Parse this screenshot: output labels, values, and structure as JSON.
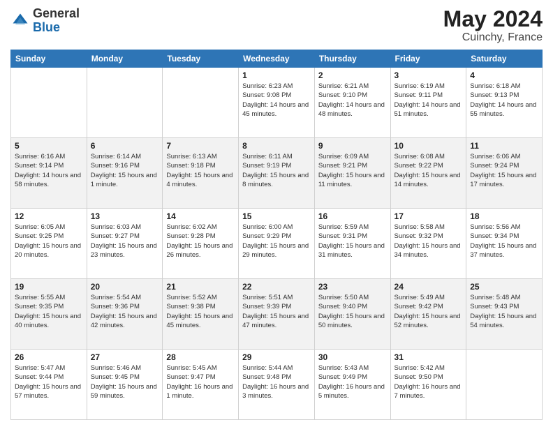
{
  "header": {
    "logo_general": "General",
    "logo_blue": "Blue",
    "month": "May 2024",
    "location": "Cuinchy, France"
  },
  "weekdays": [
    "Sunday",
    "Monday",
    "Tuesday",
    "Wednesday",
    "Thursday",
    "Friday",
    "Saturday"
  ],
  "weeks": [
    [
      {
        "day": "",
        "sunrise": "",
        "sunset": "",
        "daylight": ""
      },
      {
        "day": "",
        "sunrise": "",
        "sunset": "",
        "daylight": ""
      },
      {
        "day": "",
        "sunrise": "",
        "sunset": "",
        "daylight": ""
      },
      {
        "day": "1",
        "sunrise": "Sunrise: 6:23 AM",
        "sunset": "Sunset: 9:08 PM",
        "daylight": "Daylight: 14 hours and 45 minutes."
      },
      {
        "day": "2",
        "sunrise": "Sunrise: 6:21 AM",
        "sunset": "Sunset: 9:10 PM",
        "daylight": "Daylight: 14 hours and 48 minutes."
      },
      {
        "day": "3",
        "sunrise": "Sunrise: 6:19 AM",
        "sunset": "Sunset: 9:11 PM",
        "daylight": "Daylight: 14 hours and 51 minutes."
      },
      {
        "day": "4",
        "sunrise": "Sunrise: 6:18 AM",
        "sunset": "Sunset: 9:13 PM",
        "daylight": "Daylight: 14 hours and 55 minutes."
      }
    ],
    [
      {
        "day": "5",
        "sunrise": "Sunrise: 6:16 AM",
        "sunset": "Sunset: 9:14 PM",
        "daylight": "Daylight: 14 hours and 58 minutes."
      },
      {
        "day": "6",
        "sunrise": "Sunrise: 6:14 AM",
        "sunset": "Sunset: 9:16 PM",
        "daylight": "Daylight: 15 hours and 1 minute."
      },
      {
        "day": "7",
        "sunrise": "Sunrise: 6:13 AM",
        "sunset": "Sunset: 9:18 PM",
        "daylight": "Daylight: 15 hours and 4 minutes."
      },
      {
        "day": "8",
        "sunrise": "Sunrise: 6:11 AM",
        "sunset": "Sunset: 9:19 PM",
        "daylight": "Daylight: 15 hours and 8 minutes."
      },
      {
        "day": "9",
        "sunrise": "Sunrise: 6:09 AM",
        "sunset": "Sunset: 9:21 PM",
        "daylight": "Daylight: 15 hours and 11 minutes."
      },
      {
        "day": "10",
        "sunrise": "Sunrise: 6:08 AM",
        "sunset": "Sunset: 9:22 PM",
        "daylight": "Daylight: 15 hours and 14 minutes."
      },
      {
        "day": "11",
        "sunrise": "Sunrise: 6:06 AM",
        "sunset": "Sunset: 9:24 PM",
        "daylight": "Daylight: 15 hours and 17 minutes."
      }
    ],
    [
      {
        "day": "12",
        "sunrise": "Sunrise: 6:05 AM",
        "sunset": "Sunset: 9:25 PM",
        "daylight": "Daylight: 15 hours and 20 minutes."
      },
      {
        "day": "13",
        "sunrise": "Sunrise: 6:03 AM",
        "sunset": "Sunset: 9:27 PM",
        "daylight": "Daylight: 15 hours and 23 minutes."
      },
      {
        "day": "14",
        "sunrise": "Sunrise: 6:02 AM",
        "sunset": "Sunset: 9:28 PM",
        "daylight": "Daylight: 15 hours and 26 minutes."
      },
      {
        "day": "15",
        "sunrise": "Sunrise: 6:00 AM",
        "sunset": "Sunset: 9:29 PM",
        "daylight": "Daylight: 15 hours and 29 minutes."
      },
      {
        "day": "16",
        "sunrise": "Sunrise: 5:59 AM",
        "sunset": "Sunset: 9:31 PM",
        "daylight": "Daylight: 15 hours and 31 minutes."
      },
      {
        "day": "17",
        "sunrise": "Sunrise: 5:58 AM",
        "sunset": "Sunset: 9:32 PM",
        "daylight": "Daylight: 15 hours and 34 minutes."
      },
      {
        "day": "18",
        "sunrise": "Sunrise: 5:56 AM",
        "sunset": "Sunset: 9:34 PM",
        "daylight": "Daylight: 15 hours and 37 minutes."
      }
    ],
    [
      {
        "day": "19",
        "sunrise": "Sunrise: 5:55 AM",
        "sunset": "Sunset: 9:35 PM",
        "daylight": "Daylight: 15 hours and 40 minutes."
      },
      {
        "day": "20",
        "sunrise": "Sunrise: 5:54 AM",
        "sunset": "Sunset: 9:36 PM",
        "daylight": "Daylight: 15 hours and 42 minutes."
      },
      {
        "day": "21",
        "sunrise": "Sunrise: 5:52 AM",
        "sunset": "Sunset: 9:38 PM",
        "daylight": "Daylight: 15 hours and 45 minutes."
      },
      {
        "day": "22",
        "sunrise": "Sunrise: 5:51 AM",
        "sunset": "Sunset: 9:39 PM",
        "daylight": "Daylight: 15 hours and 47 minutes."
      },
      {
        "day": "23",
        "sunrise": "Sunrise: 5:50 AM",
        "sunset": "Sunset: 9:40 PM",
        "daylight": "Daylight: 15 hours and 50 minutes."
      },
      {
        "day": "24",
        "sunrise": "Sunrise: 5:49 AM",
        "sunset": "Sunset: 9:42 PM",
        "daylight": "Daylight: 15 hours and 52 minutes."
      },
      {
        "day": "25",
        "sunrise": "Sunrise: 5:48 AM",
        "sunset": "Sunset: 9:43 PM",
        "daylight": "Daylight: 15 hours and 54 minutes."
      }
    ],
    [
      {
        "day": "26",
        "sunrise": "Sunrise: 5:47 AM",
        "sunset": "Sunset: 9:44 PM",
        "daylight": "Daylight: 15 hours and 57 minutes."
      },
      {
        "day": "27",
        "sunrise": "Sunrise: 5:46 AM",
        "sunset": "Sunset: 9:45 PM",
        "daylight": "Daylight: 15 hours and 59 minutes."
      },
      {
        "day": "28",
        "sunrise": "Sunrise: 5:45 AM",
        "sunset": "Sunset: 9:47 PM",
        "daylight": "Daylight: 16 hours and 1 minute."
      },
      {
        "day": "29",
        "sunrise": "Sunrise: 5:44 AM",
        "sunset": "Sunset: 9:48 PM",
        "daylight": "Daylight: 16 hours and 3 minutes."
      },
      {
        "day": "30",
        "sunrise": "Sunrise: 5:43 AM",
        "sunset": "Sunset: 9:49 PM",
        "daylight": "Daylight: 16 hours and 5 minutes."
      },
      {
        "day": "31",
        "sunrise": "Sunrise: 5:42 AM",
        "sunset": "Sunset: 9:50 PM",
        "daylight": "Daylight: 16 hours and 7 minutes."
      },
      {
        "day": "",
        "sunrise": "",
        "sunset": "",
        "daylight": ""
      }
    ]
  ]
}
